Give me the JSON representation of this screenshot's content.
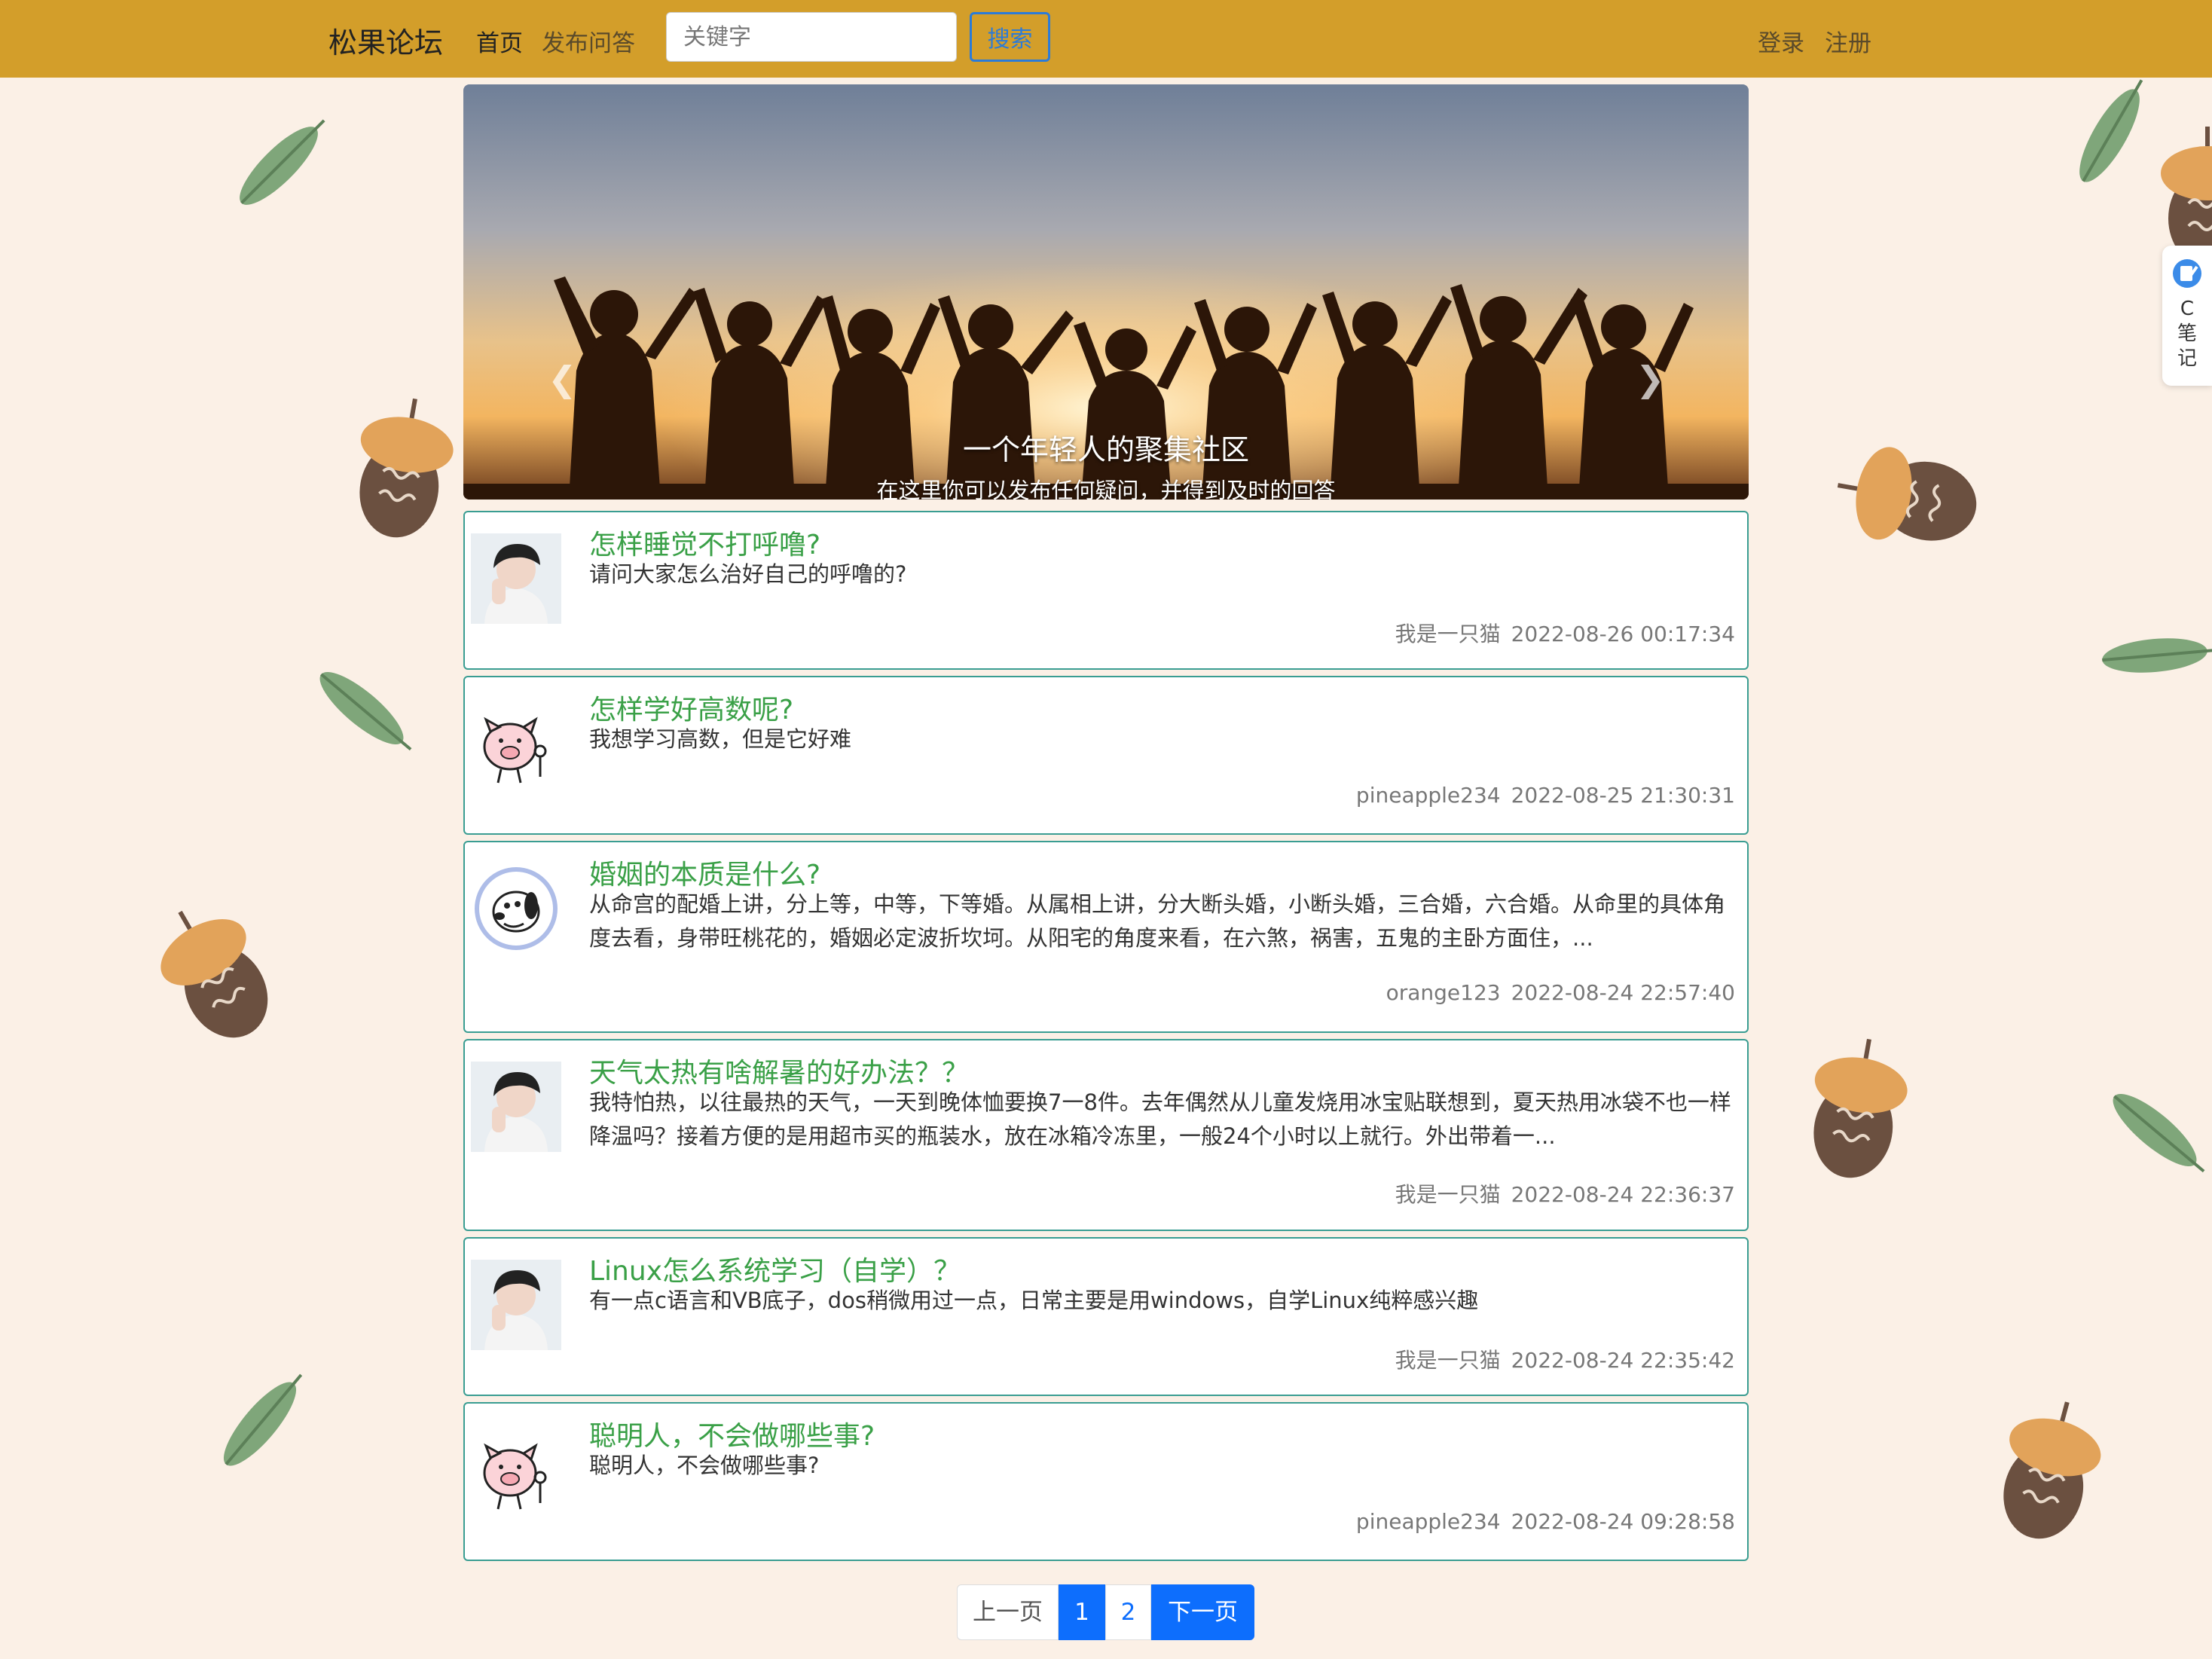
{
  "navbar": {
    "brand": "松果论坛",
    "home": "首页",
    "post_question": "发布问答",
    "search_placeholder": "关键字",
    "search_button": "搜索",
    "login": "登录",
    "register": "注册"
  },
  "side_widget": {
    "label": "C\n笔\n记",
    "icon": "note-pen-icon"
  },
  "carousel": {
    "title": "一个年轻人的聚集社区",
    "subtitle": "在这里你可以发布任何疑问，并得到及时的回答",
    "active_slide": 2,
    "slide_count": 3
  },
  "questions": [
    {
      "title": "怎样睡觉不打呼噜?",
      "body": "请问大家怎么治好自己的呼噜的?",
      "author": "我是一只猫",
      "time": "2022-08-26 00:17:34",
      "avatar": "boy-avatar"
    },
    {
      "title": "怎样学好高数呢?",
      "body": "我想学习高数，但是它好难",
      "author": "pineapple234",
      "time": "2022-08-25 21:30:31",
      "avatar": "pig-avatar"
    },
    {
      "title": "婚姻的本质是什么?",
      "body": "从命宫的配婚上讲，分上等，中等，下等婚。从属相上讲，分大断头婚，小断头婚，三合婚，六合婚。从命里的具体角度去看，身带旺桃花的，婚姻必定波折坎坷。从阳宅的角度来看，在六煞，祸害，五鬼的主卧方面住，...",
      "author": "orange123",
      "time": "2022-08-24 22:57:40",
      "avatar": "snoopy-avatar"
    },
    {
      "title": "天气太热有啥解暑的好办法？？",
      "body": "我特怕热，以往最热的天气，一天到晚体恤要换7一8件。去年偶然从儿童发烧用冰宝贴联想到，夏天热用冰袋不也一样降温吗？接着方便的是用超市买的瓶装水，放在冰箱冷冻里，一般24个小时以上就行。外出带着一...",
      "author": "我是一只猫",
      "time": "2022-08-24 22:36:37",
      "avatar": "boy-avatar"
    },
    {
      "title": "Linux怎么系统学习（自学）？",
      "body": "有一点c语言和VB底子，dos稍微用过一点，日常主要是用windows，自学Linux纯粹感兴趣",
      "author": "我是一只猫",
      "time": "2022-08-24 22:35:42",
      "avatar": "boy-avatar"
    },
    {
      "title": "聪明人，不会做哪些事?",
      "body": "聪明人，不会做哪些事?",
      "author": "pineapple234",
      "time": "2022-08-24 09:28:58",
      "avatar": "pig-avatar"
    }
  ],
  "pagination": {
    "prev": "上一页",
    "pages": [
      "1",
      "2"
    ],
    "current": "1",
    "next": "下一页"
  },
  "colors": {
    "navbar": "#d39e2a",
    "title_green": "#3aa047",
    "card_border": "#3a9d92",
    "primary": "#0d6efd",
    "page_bg": "#fbf0e6"
  }
}
